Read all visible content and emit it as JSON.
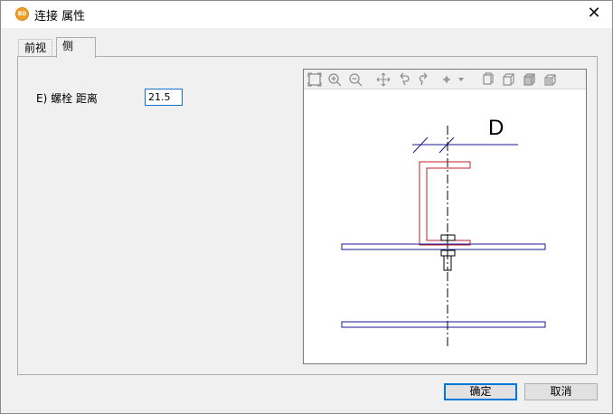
{
  "window": {
    "title": "连接 属性",
    "app_icon_text": "BD",
    "close_glyph": "✕"
  },
  "tabs": [
    {
      "label": "前视"
    },
    {
      "label": "侧"
    }
  ],
  "active_tab": "侧",
  "field": {
    "label": "E) 螺栓 距离",
    "value": "21.5"
  },
  "preview": {
    "dimension_label": "D",
    "toolbar_icons": [
      "zoom-extents-icon",
      "zoom-in-icon",
      "zoom-out-icon",
      "pan-icon",
      "rotate-left-icon",
      "rotate-right-icon",
      "view-menu-icon",
      "view-front-icon",
      "view-side-icon",
      "view-top-icon",
      "view-iso-icon"
    ],
    "colors": {
      "profile": "#c0202a",
      "plate": "#1a1a8c",
      "dimension": "#1a1a8c",
      "bolt": "#000000"
    }
  },
  "buttons": {
    "ok": "确定",
    "cancel": "取消"
  }
}
